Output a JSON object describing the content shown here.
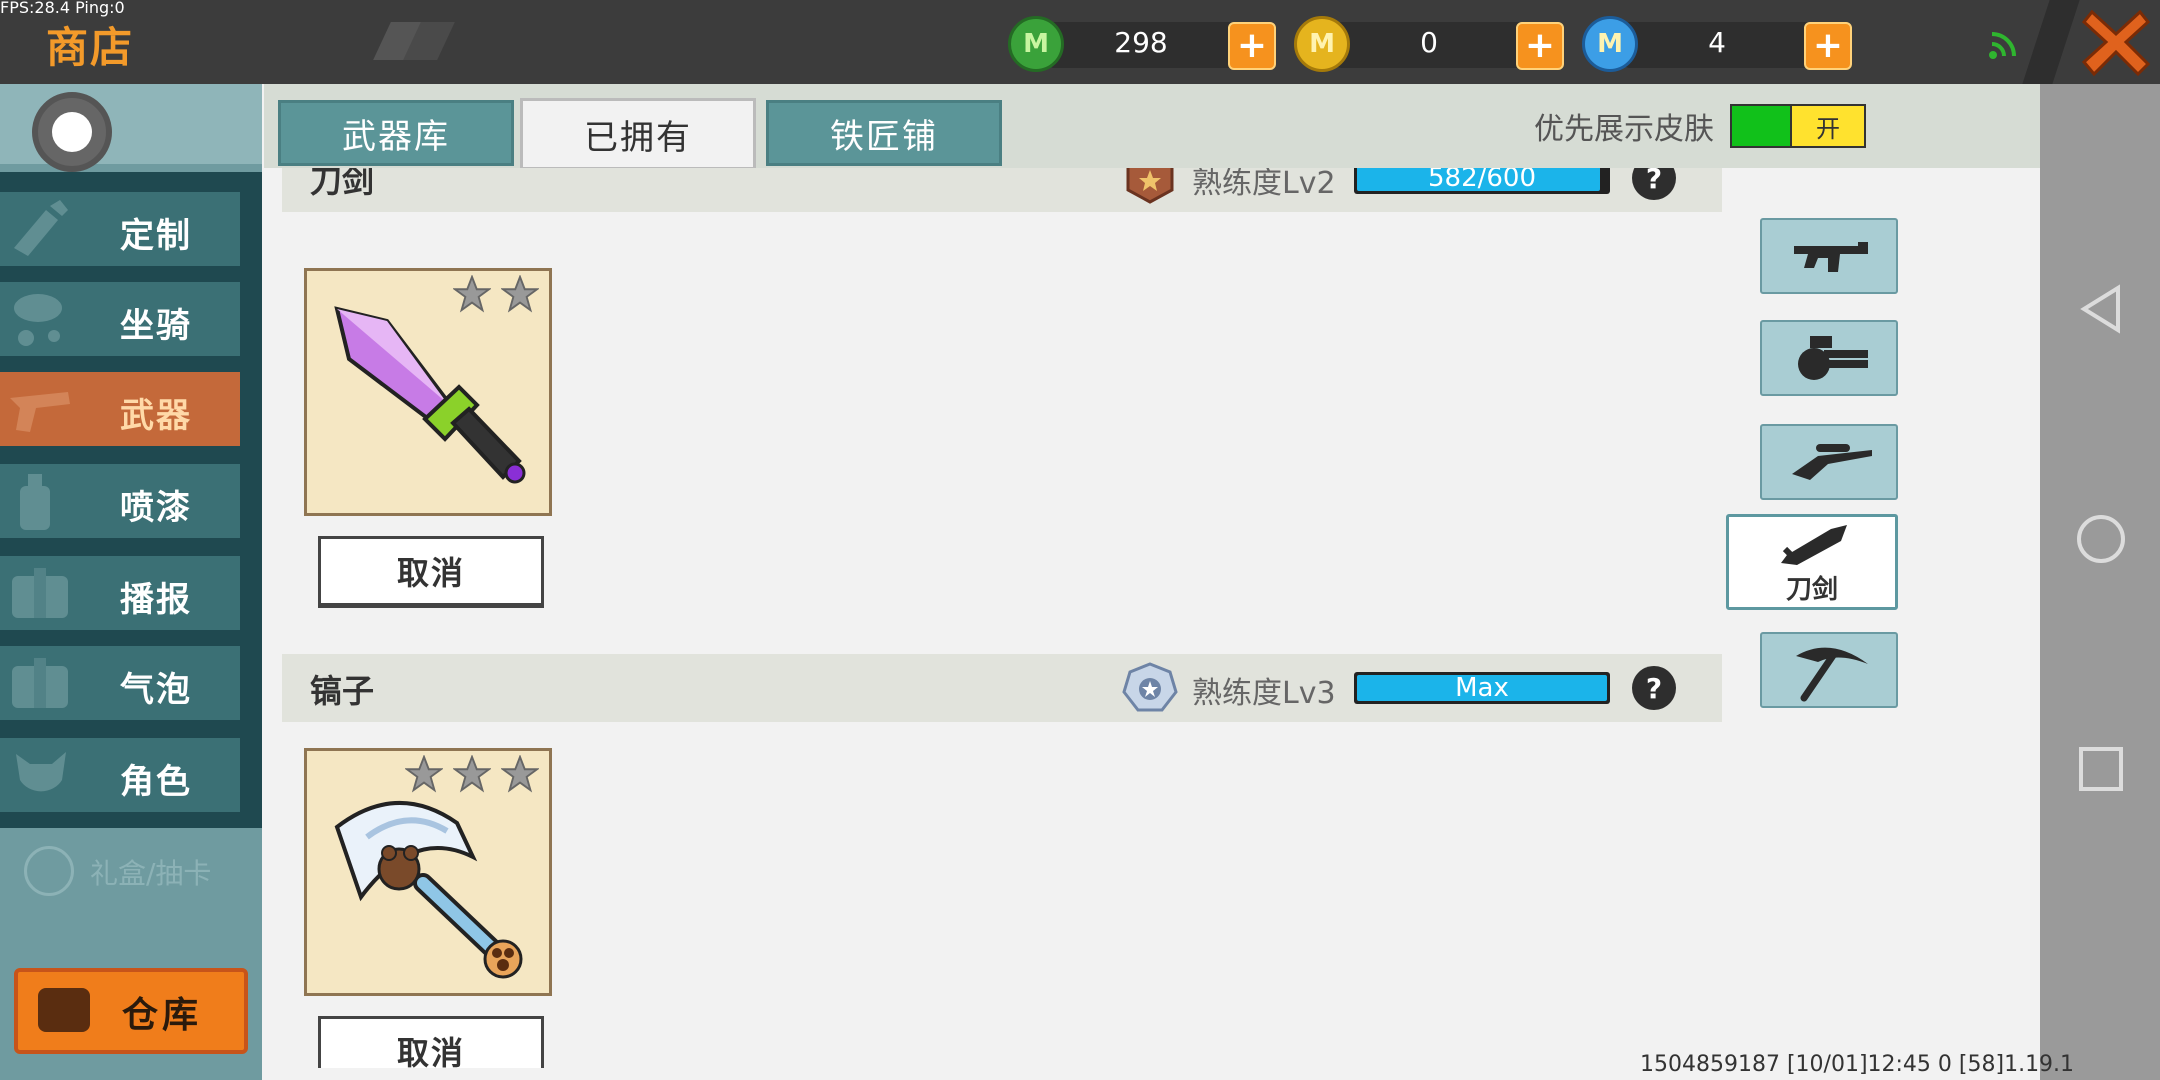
{
  "overlay": {
    "fps": "FPS:28.4  Ping:0"
  },
  "header": {
    "title": "商店",
    "currencies": [
      {
        "icon": "green-mini-coin-icon",
        "value": "298",
        "color": "#3aa23a"
      },
      {
        "icon": "gold-mini-coin-icon",
        "value": "0",
        "color": "#e5b41e"
      },
      {
        "icon": "blue-mini-coin-icon",
        "value": "4",
        "color": "#3c9ee6"
      }
    ],
    "coin_letter": "M"
  },
  "sidebar": {
    "items": [
      {
        "label": "定制",
        "icon": "brush-icon"
      },
      {
        "label": "坐骑",
        "icon": "mount-icon"
      },
      {
        "label": "武器",
        "icon": "revolver-icon",
        "active": true
      },
      {
        "label": "喷漆",
        "icon": "spray-can-icon"
      },
      {
        "label": "播报",
        "icon": "box-icon"
      },
      {
        "label": "气泡",
        "icon": "bubble-icon"
      },
      {
        "label": "角色",
        "icon": "character-icon"
      }
    ],
    "extra_label": "礼盒/抽卡",
    "warehouse_label": "仓库"
  },
  "tabs": [
    {
      "label": "武器库",
      "active": false
    },
    {
      "label": "已拥有",
      "active": true
    },
    {
      "label": "铁匠铺",
      "active": false
    }
  ],
  "skin_priority": {
    "label": "优先展示皮肤",
    "toggle_label": "开",
    "enabled": true
  },
  "categories": [
    {
      "name": "刀剑",
      "proficiency_label": "熟练度Lv2",
      "progress_text": "582/600",
      "progress_fraction": 0.97,
      "items": [
        {
          "stars": 2,
          "action_label": "取消"
        }
      ]
    },
    {
      "name": "镐子",
      "proficiency_label": "熟练度Lv3",
      "progress_text": "Max",
      "progress_fraction": 1.0,
      "items": [
        {
          "stars": 3,
          "action_label": "取消"
        }
      ]
    }
  ],
  "filters": [
    {
      "icon": "smg-icon",
      "label": ""
    },
    {
      "icon": "minigun-icon",
      "label": ""
    },
    {
      "icon": "sniper-rifle-icon",
      "label": ""
    },
    {
      "icon": "sword-icon",
      "label": "刀剑",
      "active": true
    },
    {
      "icon": "pickaxe-icon",
      "label": ""
    }
  ],
  "footer": {
    "info": "1504859187   [10/01]12:45 0   [58]1.19.1"
  },
  "help_symbol": "?"
}
